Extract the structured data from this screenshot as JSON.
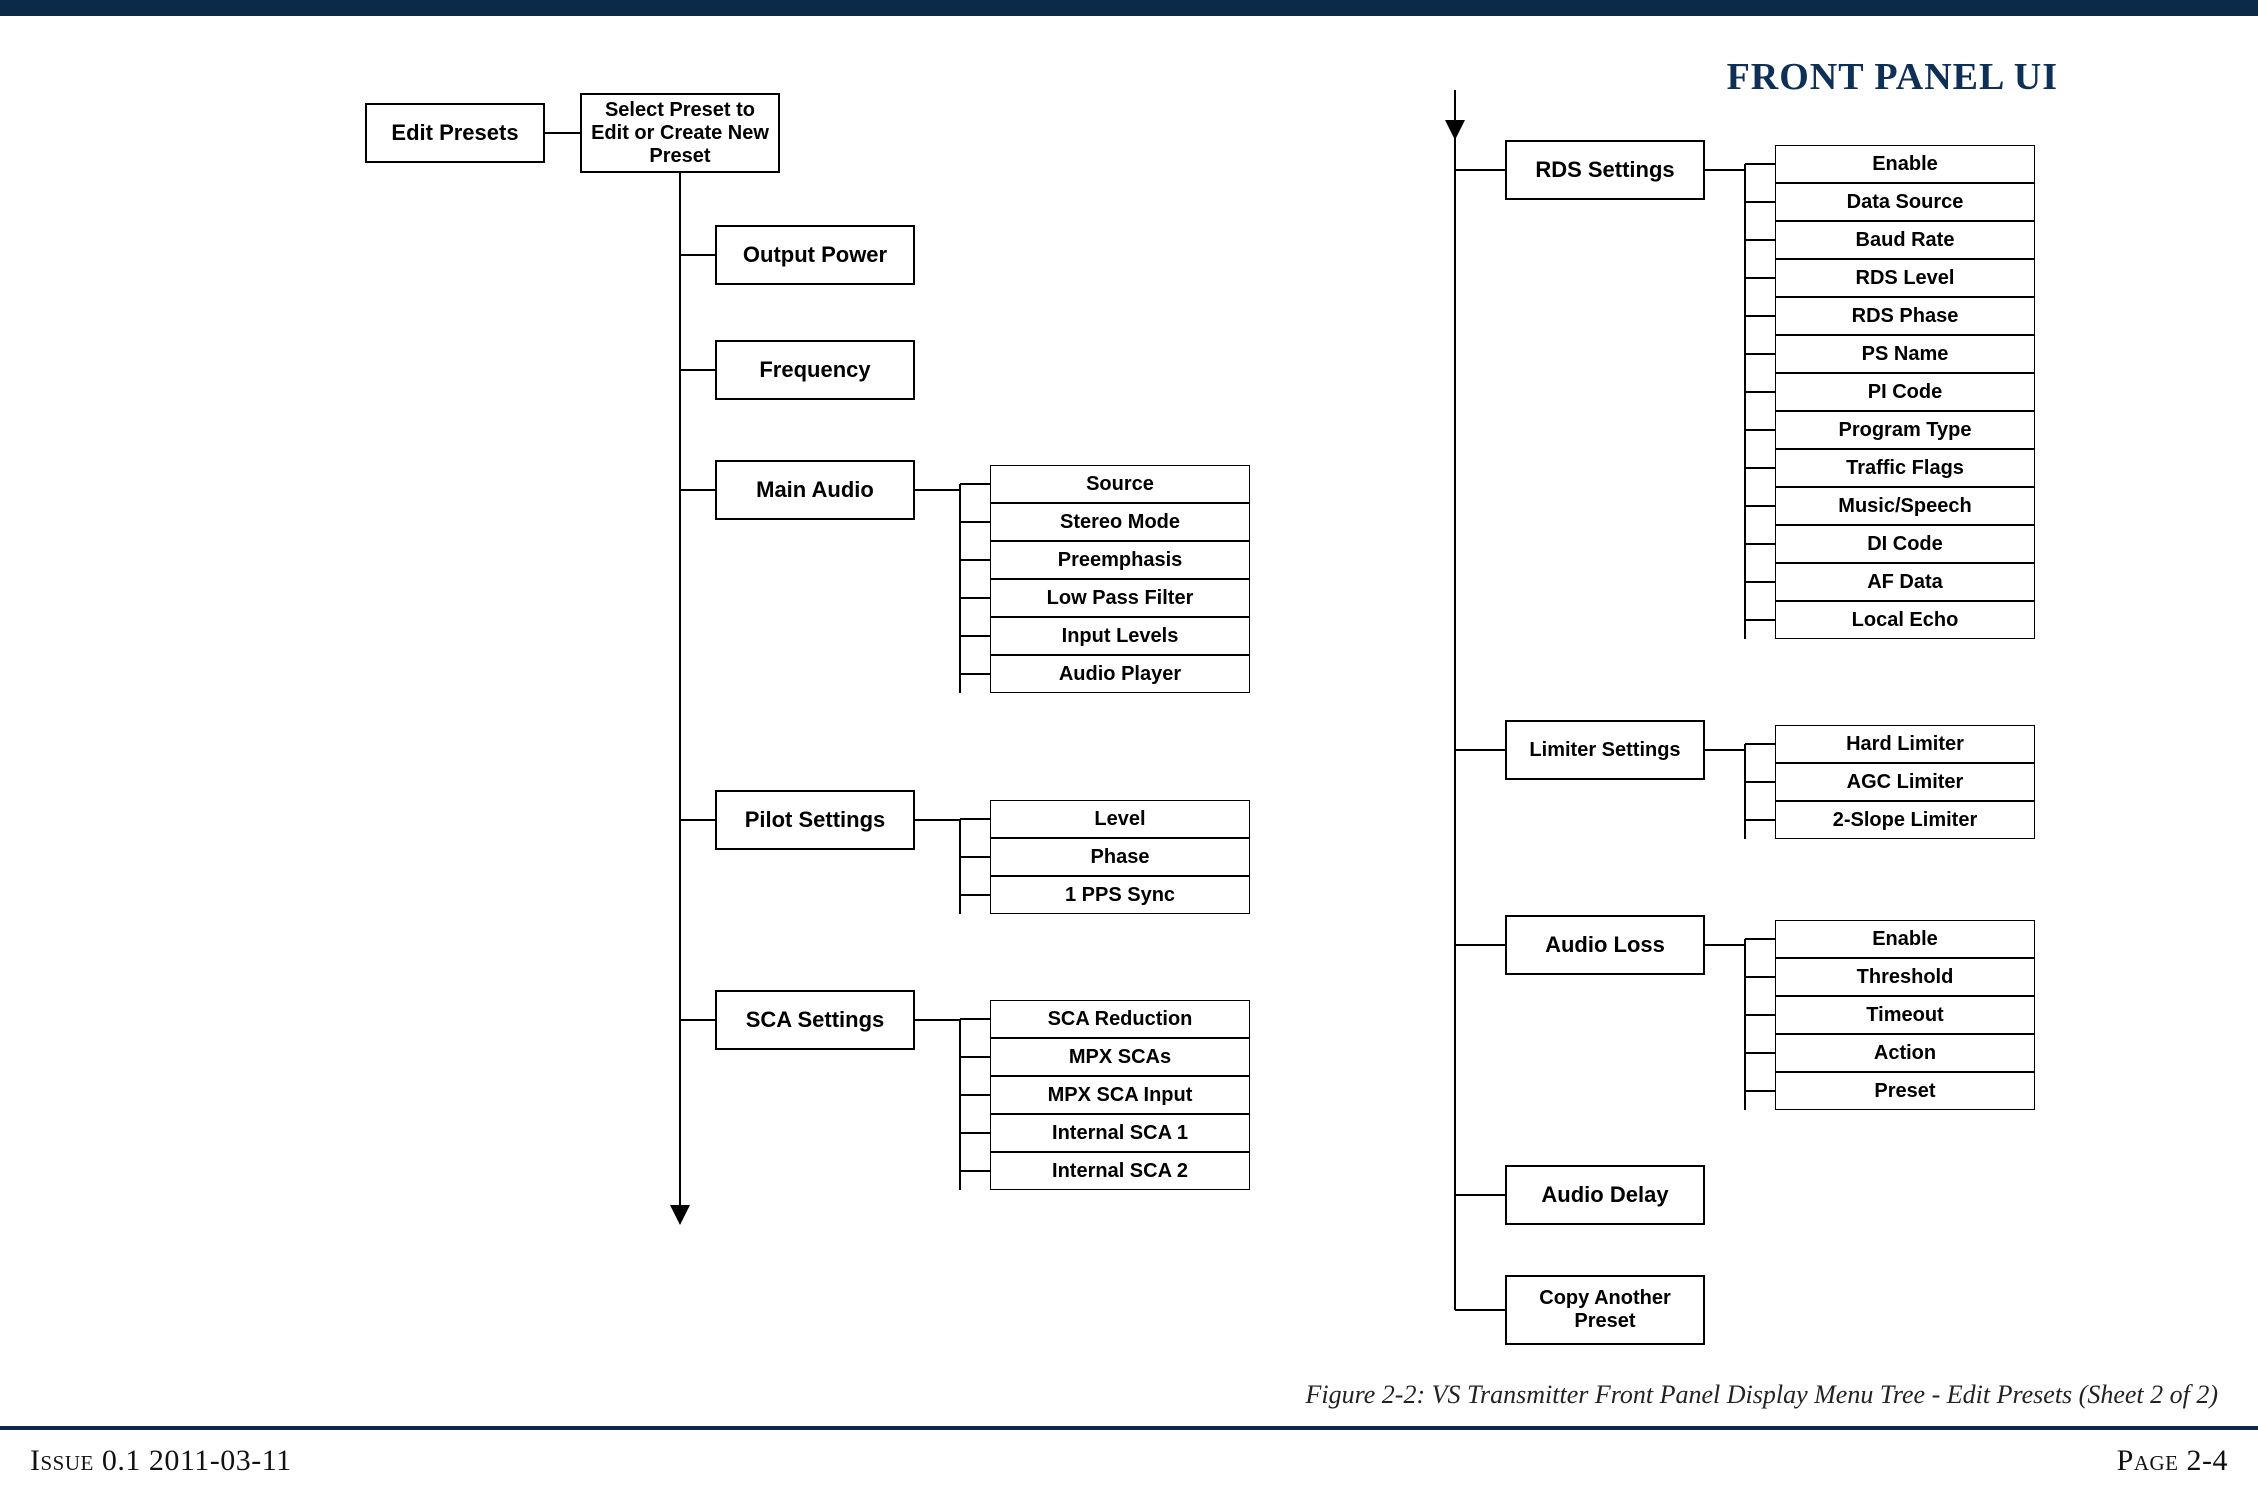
{
  "header": {
    "title": "FRONT PANEL UI"
  },
  "footer": {
    "caption": "Figure 2-2: VS Transmitter Front Panel Display Menu Tree - Edit Presets (Sheet 2 of 2)",
    "issue": "Issue 0.1  2011-03-11",
    "page": "Page 2-4"
  },
  "left": {
    "edit_presets": "Edit Presets",
    "select_preset": "Select Preset to Edit or Create New Preset",
    "output_power": "Output Power",
    "frequency": "Frequency",
    "main_audio": {
      "label": "Main Audio",
      "items": [
        "Source",
        "Stereo Mode",
        "Preemphasis",
        "Low Pass Filter",
        "Input Levels",
        "Audio Player"
      ]
    },
    "pilot": {
      "label": "Pilot Settings",
      "items": [
        "Level",
        "Phase",
        "1 PPS Sync"
      ]
    },
    "sca": {
      "label": "SCA Settings",
      "items": [
        "SCA Reduction",
        "MPX SCAs",
        "MPX SCA Input",
        "Internal SCA 1",
        "Internal SCA 2"
      ]
    }
  },
  "right": {
    "rds": {
      "label": "RDS Settings",
      "items": [
        "Enable",
        "Data Source",
        "Baud Rate",
        "RDS Level",
        "RDS Phase",
        "PS Name",
        "PI Code",
        "Program Type",
        "Traffic Flags",
        "Music/Speech",
        "DI Code",
        "AF Data",
        "Local Echo"
      ]
    },
    "limiter": {
      "label": "Limiter Settings",
      "items": [
        "Hard Limiter",
        "AGC Limiter",
        "2-Slope Limiter"
      ]
    },
    "audio_loss": {
      "label": "Audio Loss",
      "items": [
        "Enable",
        "Threshold",
        "Timeout",
        "Action",
        "Preset"
      ]
    },
    "audio_delay": {
      "label": "Audio Delay"
    },
    "copy": {
      "label": "Copy Another Preset"
    }
  }
}
